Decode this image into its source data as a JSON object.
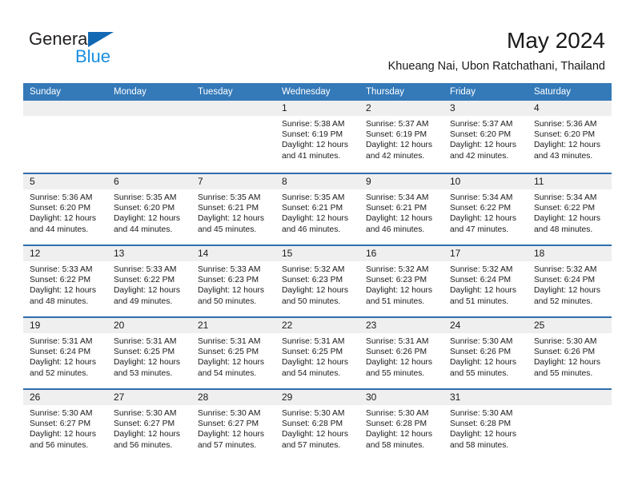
{
  "brand": {
    "name_top": "General",
    "name_bottom": "Blue",
    "triangle_color": "#1268b3",
    "blue_text_color": "#1a8fe0"
  },
  "header": {
    "title": "May 2024",
    "subtitle": "Khueang Nai, Ubon Ratchathani, Thailand"
  },
  "theme": {
    "header_row_bg": "#3479b8",
    "row_divider": "#2f6fab",
    "daynum_band_bg": "#efeff0"
  },
  "weekdays": [
    "Sunday",
    "Monday",
    "Tuesday",
    "Wednesday",
    "Thursday",
    "Friday",
    "Saturday"
  ],
  "weeks": [
    [
      {
        "day": "",
        "lines": []
      },
      {
        "day": "",
        "lines": []
      },
      {
        "day": "",
        "lines": []
      },
      {
        "day": "1",
        "lines": [
          "Sunrise: 5:38 AM",
          "Sunset: 6:19 PM",
          "Daylight: 12 hours",
          "and 41 minutes."
        ]
      },
      {
        "day": "2",
        "lines": [
          "Sunrise: 5:37 AM",
          "Sunset: 6:19 PM",
          "Daylight: 12 hours",
          "and 42 minutes."
        ]
      },
      {
        "day": "3",
        "lines": [
          "Sunrise: 5:37 AM",
          "Sunset: 6:20 PM",
          "Daylight: 12 hours",
          "and 42 minutes."
        ]
      },
      {
        "day": "4",
        "lines": [
          "Sunrise: 5:36 AM",
          "Sunset: 6:20 PM",
          "Daylight: 12 hours",
          "and 43 minutes."
        ]
      }
    ],
    [
      {
        "day": "5",
        "lines": [
          "Sunrise: 5:36 AM",
          "Sunset: 6:20 PM",
          "Daylight: 12 hours",
          "and 44 minutes."
        ]
      },
      {
        "day": "6",
        "lines": [
          "Sunrise: 5:35 AM",
          "Sunset: 6:20 PM",
          "Daylight: 12 hours",
          "and 44 minutes."
        ]
      },
      {
        "day": "7",
        "lines": [
          "Sunrise: 5:35 AM",
          "Sunset: 6:21 PM",
          "Daylight: 12 hours",
          "and 45 minutes."
        ]
      },
      {
        "day": "8",
        "lines": [
          "Sunrise: 5:35 AM",
          "Sunset: 6:21 PM",
          "Daylight: 12 hours",
          "and 46 minutes."
        ]
      },
      {
        "day": "9",
        "lines": [
          "Sunrise: 5:34 AM",
          "Sunset: 6:21 PM",
          "Daylight: 12 hours",
          "and 46 minutes."
        ]
      },
      {
        "day": "10",
        "lines": [
          "Sunrise: 5:34 AM",
          "Sunset: 6:22 PM",
          "Daylight: 12 hours",
          "and 47 minutes."
        ]
      },
      {
        "day": "11",
        "lines": [
          "Sunrise: 5:34 AM",
          "Sunset: 6:22 PM",
          "Daylight: 12 hours",
          "and 48 minutes."
        ]
      }
    ],
    [
      {
        "day": "12",
        "lines": [
          "Sunrise: 5:33 AM",
          "Sunset: 6:22 PM",
          "Daylight: 12 hours",
          "and 48 minutes."
        ]
      },
      {
        "day": "13",
        "lines": [
          "Sunrise: 5:33 AM",
          "Sunset: 6:22 PM",
          "Daylight: 12 hours",
          "and 49 minutes."
        ]
      },
      {
        "day": "14",
        "lines": [
          "Sunrise: 5:33 AM",
          "Sunset: 6:23 PM",
          "Daylight: 12 hours",
          "and 50 minutes."
        ]
      },
      {
        "day": "15",
        "lines": [
          "Sunrise: 5:32 AM",
          "Sunset: 6:23 PM",
          "Daylight: 12 hours",
          "and 50 minutes."
        ]
      },
      {
        "day": "16",
        "lines": [
          "Sunrise: 5:32 AM",
          "Sunset: 6:23 PM",
          "Daylight: 12 hours",
          "and 51 minutes."
        ]
      },
      {
        "day": "17",
        "lines": [
          "Sunrise: 5:32 AM",
          "Sunset: 6:24 PM",
          "Daylight: 12 hours",
          "and 51 minutes."
        ]
      },
      {
        "day": "18",
        "lines": [
          "Sunrise: 5:32 AM",
          "Sunset: 6:24 PM",
          "Daylight: 12 hours",
          "and 52 minutes."
        ]
      }
    ],
    [
      {
        "day": "19",
        "lines": [
          "Sunrise: 5:31 AM",
          "Sunset: 6:24 PM",
          "Daylight: 12 hours",
          "and 52 minutes."
        ]
      },
      {
        "day": "20",
        "lines": [
          "Sunrise: 5:31 AM",
          "Sunset: 6:25 PM",
          "Daylight: 12 hours",
          "and 53 minutes."
        ]
      },
      {
        "day": "21",
        "lines": [
          "Sunrise: 5:31 AM",
          "Sunset: 6:25 PM",
          "Daylight: 12 hours",
          "and 54 minutes."
        ]
      },
      {
        "day": "22",
        "lines": [
          "Sunrise: 5:31 AM",
          "Sunset: 6:25 PM",
          "Daylight: 12 hours",
          "and 54 minutes."
        ]
      },
      {
        "day": "23",
        "lines": [
          "Sunrise: 5:31 AM",
          "Sunset: 6:26 PM",
          "Daylight: 12 hours",
          "and 55 minutes."
        ]
      },
      {
        "day": "24",
        "lines": [
          "Sunrise: 5:30 AM",
          "Sunset: 6:26 PM",
          "Daylight: 12 hours",
          "and 55 minutes."
        ]
      },
      {
        "day": "25",
        "lines": [
          "Sunrise: 5:30 AM",
          "Sunset: 6:26 PM",
          "Daylight: 12 hours",
          "and 55 minutes."
        ]
      }
    ],
    [
      {
        "day": "26",
        "lines": [
          "Sunrise: 5:30 AM",
          "Sunset: 6:27 PM",
          "Daylight: 12 hours",
          "and 56 minutes."
        ]
      },
      {
        "day": "27",
        "lines": [
          "Sunrise: 5:30 AM",
          "Sunset: 6:27 PM",
          "Daylight: 12 hours",
          "and 56 minutes."
        ]
      },
      {
        "day": "28",
        "lines": [
          "Sunrise: 5:30 AM",
          "Sunset: 6:27 PM",
          "Daylight: 12 hours",
          "and 57 minutes."
        ]
      },
      {
        "day": "29",
        "lines": [
          "Sunrise: 5:30 AM",
          "Sunset: 6:28 PM",
          "Daylight: 12 hours",
          "and 57 minutes."
        ]
      },
      {
        "day": "30",
        "lines": [
          "Sunrise: 5:30 AM",
          "Sunset: 6:28 PM",
          "Daylight: 12 hours",
          "and 58 minutes."
        ]
      },
      {
        "day": "31",
        "lines": [
          "Sunrise: 5:30 AM",
          "Sunset: 6:28 PM",
          "Daylight: 12 hours",
          "and 58 minutes."
        ]
      },
      {
        "day": "",
        "lines": []
      }
    ]
  ]
}
